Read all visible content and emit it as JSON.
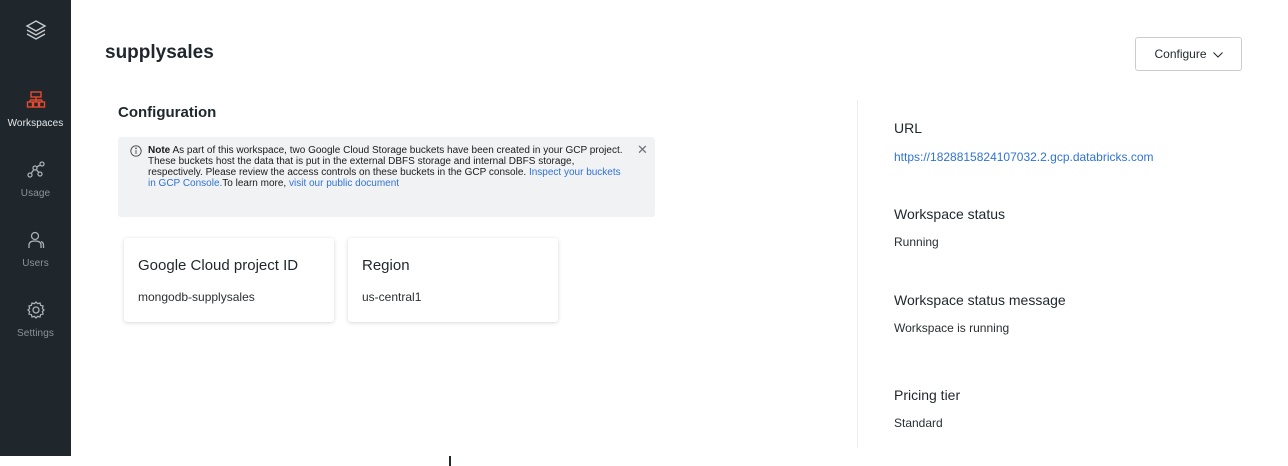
{
  "sidebar": {
    "logo_icon": "layers-logo-icon",
    "accent_color": "#e8492f",
    "items": [
      {
        "label": "Workspaces",
        "icon": "workspaces-icon",
        "active": true
      },
      {
        "label": "Usage",
        "icon": "usage-icon",
        "active": false
      },
      {
        "label": "Users",
        "icon": "user-icon",
        "active": false
      },
      {
        "label": "Settings",
        "icon": "gear-icon",
        "active": false
      }
    ]
  },
  "header": {
    "title": "supplysales",
    "configure_label": "Configure",
    "configure_icon": "chevron-down-icon"
  },
  "configuration": {
    "heading": "Configuration",
    "note": {
      "bold": "Note",
      "text": " As part of this workspace, two Google Cloud Storage buckets have been created in your GCP project. These buckets host the data that is put in the external DBFS storage and internal DBFS storage, respectively. Please review the access controls on these buckets in the GCP console. ",
      "link1": "Inspect your buckets in GCP Console.",
      "text2": "To learn more, ",
      "link2": "visit our public document",
      "close_icon": "close-icon",
      "info_icon": "info-icon"
    },
    "cards": [
      {
        "title": "Google Cloud project ID",
        "value": "mongodb-supplysales"
      },
      {
        "title": "Region",
        "value": "us-central1"
      }
    ]
  },
  "details": {
    "url_label": "URL",
    "url_value": "https://1828815824107032.2.gcp.databricks.com",
    "status_label": "Workspace status",
    "status_value": "Running",
    "status_message_label": "Workspace status message",
    "status_message_value": "Workspace is running",
    "pricing_label": "Pricing tier",
    "pricing_value": "Standard"
  },
  "colors": {
    "sidebar_bg": "#1f272c",
    "link": "#2f73d6",
    "note_bg": "#f1f2f3"
  }
}
